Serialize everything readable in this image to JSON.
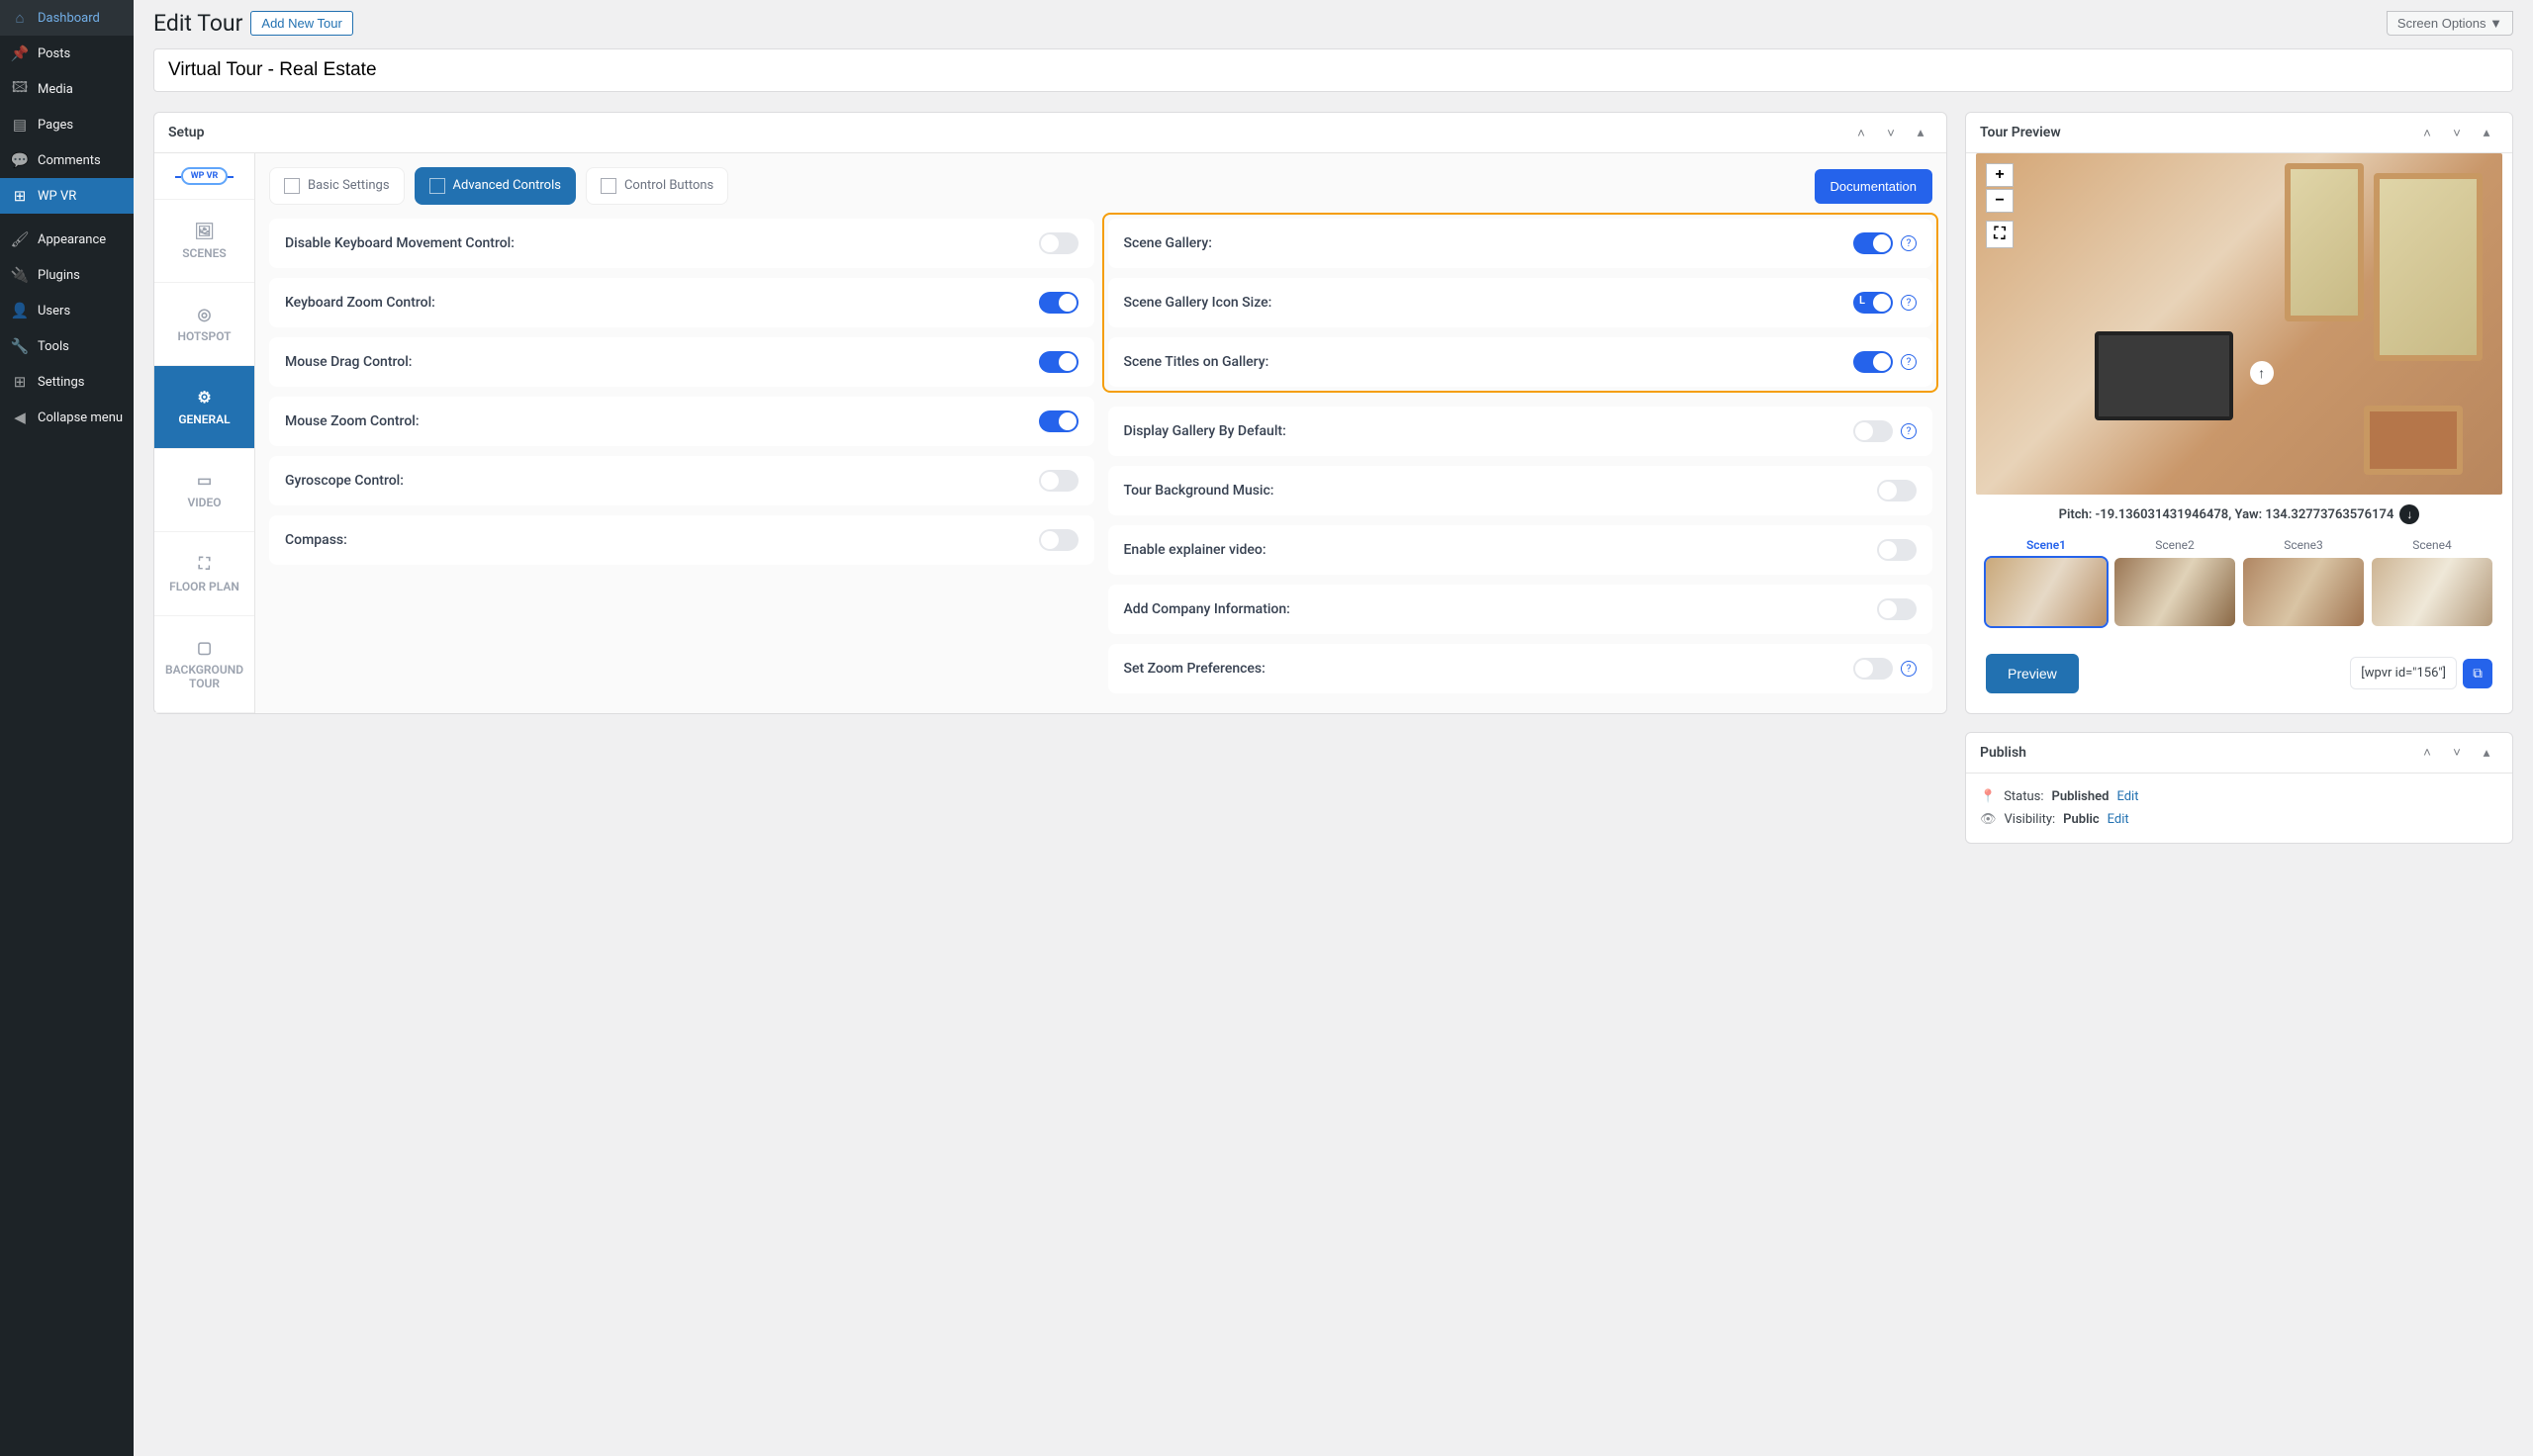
{
  "sidebar": {
    "items": [
      {
        "icon": "⌂",
        "label": "Dashboard"
      },
      {
        "icon": "📌",
        "label": "Posts"
      },
      {
        "icon": "🖾",
        "label": "Media"
      },
      {
        "icon": "▤",
        "label": "Pages"
      },
      {
        "icon": "💬",
        "label": "Comments"
      },
      {
        "icon": "⊞",
        "label": "WP VR",
        "current": true
      }
    ],
    "items2": [
      {
        "icon": "🖌",
        "label": "Appearance"
      },
      {
        "icon": "🔌",
        "label": "Plugins"
      },
      {
        "icon": "👤",
        "label": "Users"
      },
      {
        "icon": "🔧",
        "label": "Tools"
      },
      {
        "icon": "⊞",
        "label": "Settings"
      },
      {
        "icon": "◀",
        "label": "Collapse menu"
      }
    ]
  },
  "header": {
    "page_title": "Edit Tour",
    "add_new": "Add New Tour",
    "screen_options": "Screen Options ▼"
  },
  "tour_title": "Virtual Tour - Real Estate",
  "setup": {
    "box_title": "Setup",
    "vtabs": {
      "scenes": "SCENES",
      "hotspot": "HOTSPOT",
      "general": "GENERAL",
      "video": "VIDEO",
      "floorplan": "FLOOR PLAN",
      "background": "BACKGROUND TOUR"
    },
    "subtabs": {
      "basic": "Basic Settings",
      "advanced": "Advanced Controls",
      "control": "Control Buttons"
    },
    "documentation": "Documentation",
    "left": {
      "disable_kb": "Disable Keyboard Movement Control:",
      "kb_zoom": "Keyboard Zoom Control:",
      "mouse_drag": "Mouse Drag Control:",
      "mouse_zoom": "Mouse Zoom Control:",
      "gyro": "Gyroscope Control:",
      "compass": "Compass:"
    },
    "right": {
      "scene_gallery": "Scene Gallery:",
      "icon_size": "Scene Gallery Icon Size:",
      "icon_size_l": "L",
      "titles_gallery": "Scene Titles on Gallery:",
      "display_default": "Display Gallery By Default:",
      "bg_music": "Tour Background Music:",
      "explainer": "Enable explainer video:",
      "company_info": "Add Company Information:",
      "zoom_prefs": "Set Zoom Preferences:"
    }
  },
  "preview": {
    "box_title": "Tour Preview",
    "zoom_in": "+",
    "zoom_out": "−",
    "pitch_yaw": "Pitch: -19.136031431946478, Yaw: 134.32773763576174",
    "scenes": [
      "Scene1",
      "Scene2",
      "Scene3",
      "Scene4"
    ],
    "preview_btn": "Preview",
    "shortcode": "[wpvr id=\"156\"]"
  },
  "publish": {
    "box_title": "Publish",
    "status_label": "Status:",
    "status_value": "Published",
    "visibility_label": "Visibility:",
    "visibility_value": "Public",
    "edit": "Edit"
  }
}
